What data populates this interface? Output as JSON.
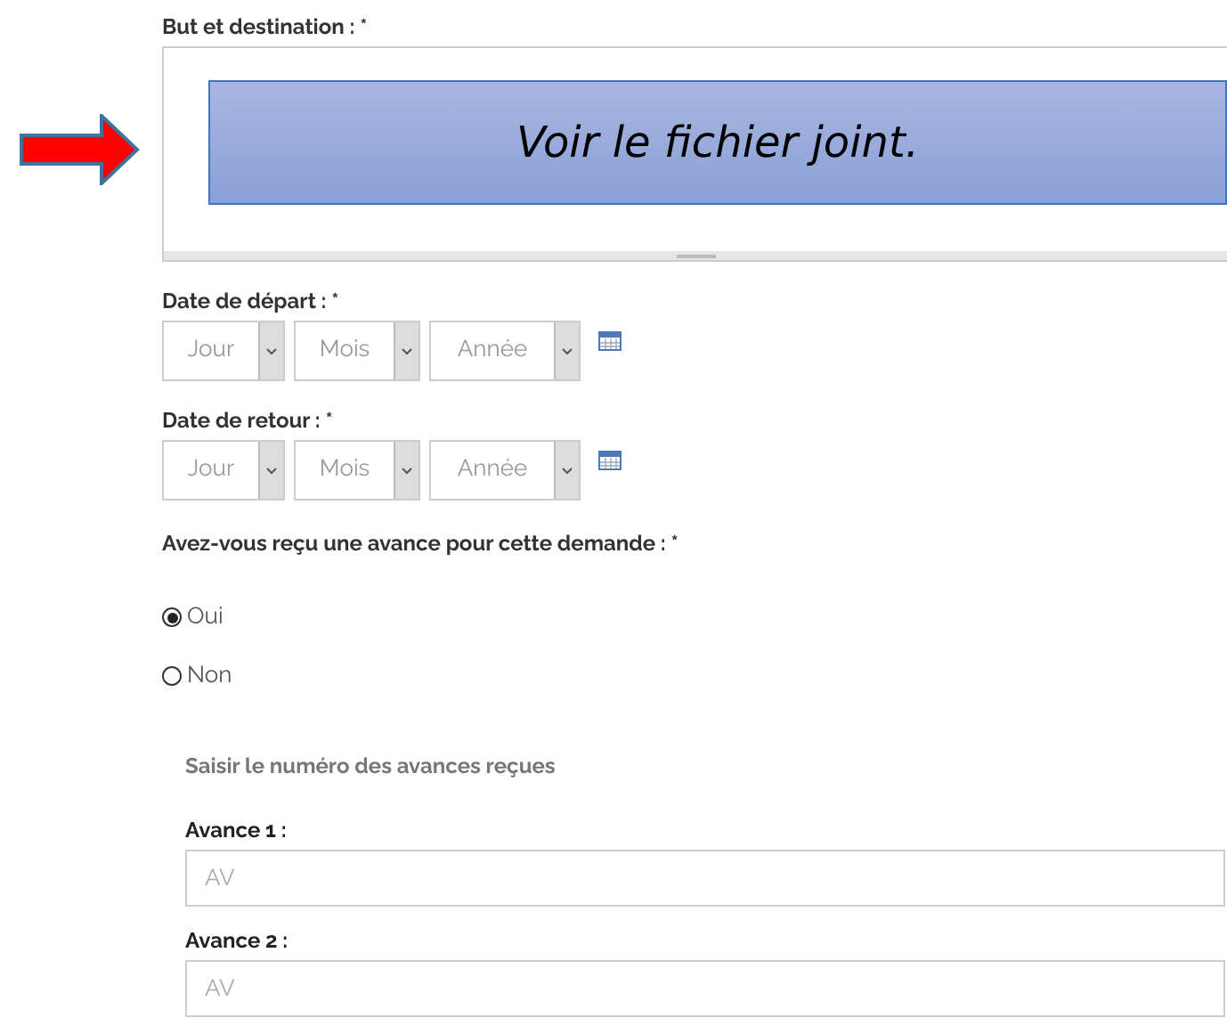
{
  "purpose": {
    "label": "But et destination : *",
    "content": "Voir le fichier joint."
  },
  "dates": [
    {
      "label": "Date de départ : *",
      "selects": [
        "Jour",
        "Mois",
        "Année"
      ]
    },
    {
      "label": "Date de retour : *",
      "selects": [
        "Jour",
        "Mois",
        "Année"
      ]
    }
  ],
  "advance_question": {
    "label": "Avez-vous reçu une avance pour cette demande : *",
    "options": [
      {
        "label": "Oui",
        "selected": true
      },
      {
        "label": "Non",
        "selected": false
      }
    ]
  },
  "advances": {
    "heading": "Saisir le numéro des avances reçues",
    "fields": [
      {
        "label": "Avance 1 :",
        "placeholder": "AV"
      },
      {
        "label": "Avance 2 :",
        "placeholder": "AV"
      }
    ]
  }
}
